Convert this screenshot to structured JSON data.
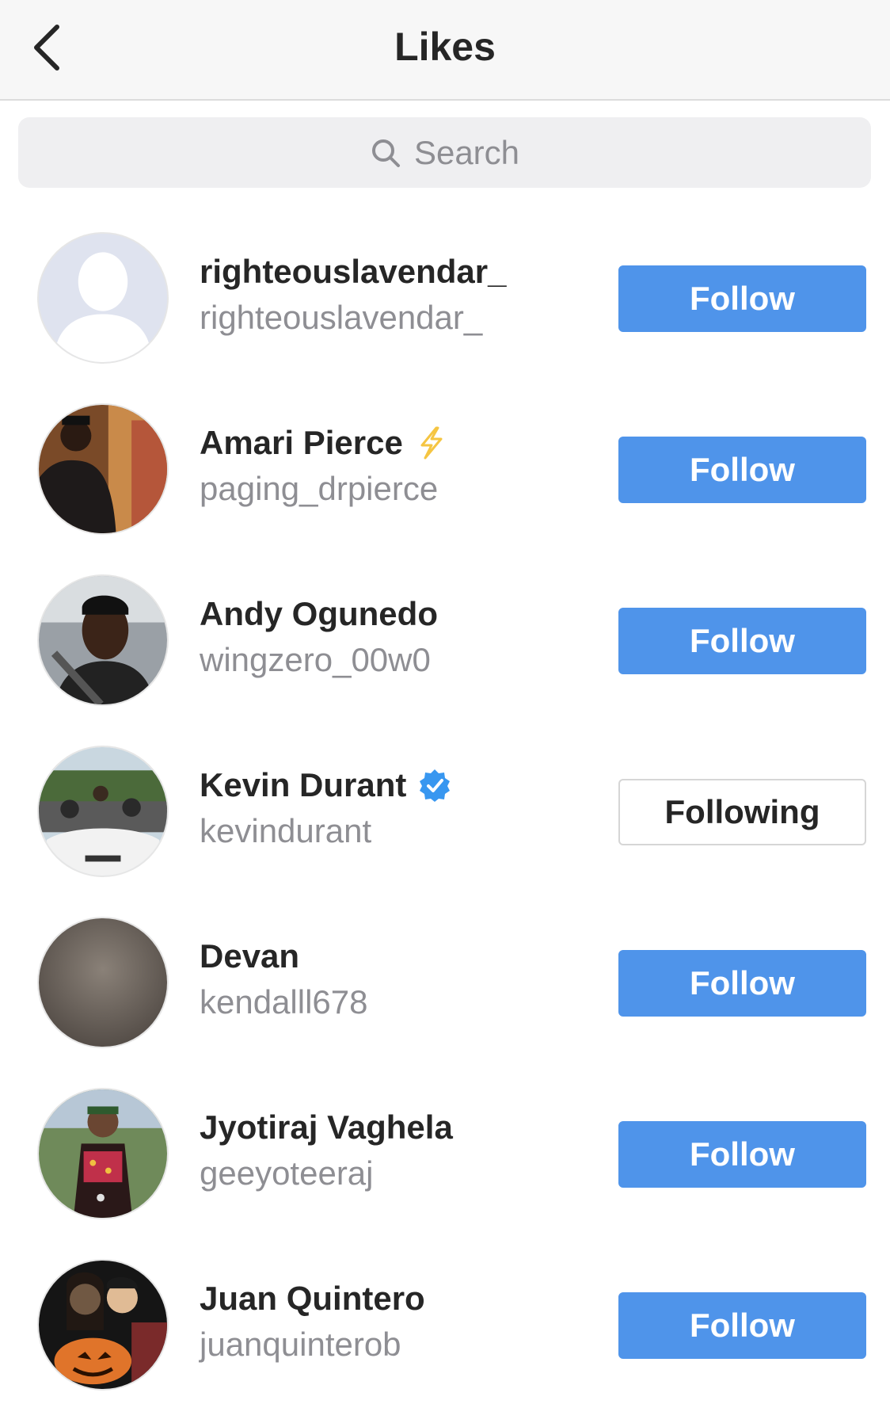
{
  "header": {
    "title": "Likes"
  },
  "search": {
    "placeholder": "Search"
  },
  "users": [
    {
      "display_name": "righteouslavendar_",
      "username": "righteouslavendar_",
      "button": "Follow",
      "badge": "none"
    },
    {
      "display_name": "Amari Pierce",
      "username": "paging_drpierce",
      "button": "Follow",
      "badge": "lightning-icon"
    },
    {
      "display_name": "Andy Ogunedo",
      "username": "wingzero_00w0",
      "button": "Follow",
      "badge": "none"
    },
    {
      "display_name": "Kevin Durant",
      "username": "kevindurant",
      "button": "Following",
      "badge": "verified-icon"
    },
    {
      "display_name": "Devan",
      "username": "kendalll678",
      "button": "Follow",
      "badge": "none"
    },
    {
      "display_name": "Jyotiraj Vaghela",
      "username": "geeyoteeraj",
      "button": "Follow",
      "badge": "none"
    },
    {
      "display_name": "Juan Quintero",
      "username": "juanquinterob",
      "button": "Follow",
      "badge": "none"
    }
  ],
  "colors": {
    "follow_button": "#4f94ea",
    "verified_badge": "#3897f0",
    "lightning": "#f5c542"
  }
}
